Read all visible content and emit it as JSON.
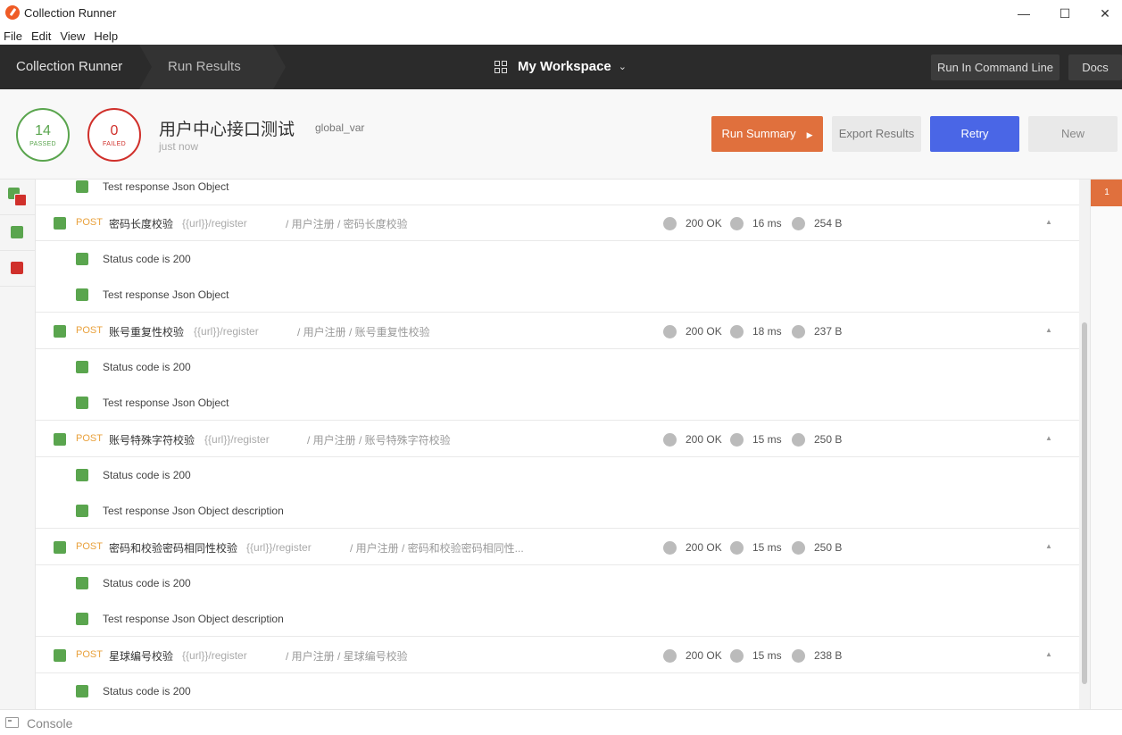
{
  "window": {
    "title": "Collection Runner",
    "minimize_glyph": "—",
    "maximize_glyph": "☐",
    "close_glyph": "✕"
  },
  "menu": [
    "File",
    "Edit",
    "View",
    "Help"
  ],
  "nav": {
    "crumbs": [
      "Collection Runner",
      "Run Results"
    ],
    "workspace": "My Workspace",
    "run_cli": "Run In Command Line",
    "docs": "Docs"
  },
  "summary": {
    "passed": "14",
    "passed_label": "PASSED",
    "failed": "0",
    "failed_label": "FAILED",
    "collection": "用户中心接口测试",
    "environment": "global_var",
    "time": "just now",
    "buttons": {
      "run_summary": "Run Summary",
      "export": "Export Results",
      "retry": "Retry",
      "new": "New"
    }
  },
  "colors": {
    "pass": "#5aa54e",
    "fail": "#d0302b",
    "accent": "#e0703d",
    "retry": "#4a66e6",
    "method": "#e9a13c"
  },
  "top_test": "Test response Json Object",
  "requests": [
    {
      "method": "POST",
      "name": "密码长度校验",
      "url": "{{url}}/register",
      "path": "/ 用户注册 / 密码长度校验",
      "status": "200 OK",
      "time": "16 ms",
      "size": "254 B",
      "tests": [
        "Status code is 200",
        "Test response Json Object"
      ]
    },
    {
      "method": "POST",
      "name": "账号重复性校验",
      "url": "{{url}}/register",
      "path": "/ 用户注册 / 账号重复性校验",
      "status": "200 OK",
      "time": "18 ms",
      "size": "237 B",
      "tests": [
        "Status code is 200",
        "Test response Json Object"
      ]
    },
    {
      "method": "POST",
      "name": "账号特殊字符校验",
      "url": "{{url}}/register",
      "path": "/ 用户注册 / 账号特殊字符校验",
      "status": "200 OK",
      "time": "15 ms",
      "size": "250 B",
      "tests": [
        "Status code is 200",
        "Test response Json Object description"
      ]
    },
    {
      "method": "POST",
      "name": "密码和校验密码相同性校验",
      "url": "{{url}}/register",
      "path": "/ 用户注册 / 密码和校验密码相同性...",
      "status": "200 OK",
      "time": "15 ms",
      "size": "250 B",
      "tests": [
        "Status code is 200",
        "Test response Json Object description"
      ]
    },
    {
      "method": "POST",
      "name": "星球编号校验",
      "url": "{{url}}/register",
      "path": "/ 用户注册 / 星球编号校验",
      "status": "200 OK",
      "time": "15 ms",
      "size": "238 B",
      "tests": [
        "Status code is 200"
      ]
    }
  ],
  "marker": "1",
  "console": "Console"
}
